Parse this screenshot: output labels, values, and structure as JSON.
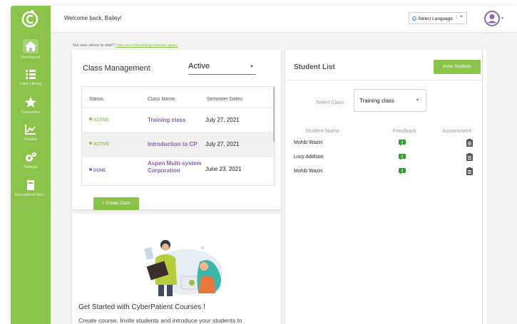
{
  "header": {
    "welcome": "Welcome back, Bailey!",
    "language_label": "Select Language",
    "language_arrow": "▼"
  },
  "sidebar": {
    "items": [
      {
        "label": "Dashboard",
        "icon": "home-icon",
        "active": true
      },
      {
        "label": "Case Library",
        "icon": "list-icon"
      },
      {
        "label": "Favourites",
        "icon": "star-icon"
      },
      {
        "label": "Grades",
        "icon": "chart-icon"
      },
      {
        "label": "Settings",
        "icon": "gears-icon"
      },
      {
        "label": "Educational Res...",
        "icon": "book-icon"
      }
    ]
  },
  "onboarding": {
    "text": "Not sure where to start?",
    "link": "View our onboarding tutorials again."
  },
  "class_management": {
    "title": "Class Management",
    "filter_value": "Active",
    "columns": [
      "Status.",
      "Class Name.",
      "Semester Dates"
    ],
    "rows": [
      {
        "status": "ACTIVE",
        "status_color": "#8bc34a",
        "name": "Training class",
        "date": "July 27, 2021"
      },
      {
        "status": "ACTIVE",
        "status_color": "#8bc34a",
        "name": "Introduction to CP",
        "date": "July 27, 2021"
      },
      {
        "status": "DONE",
        "status_color": "#7e6bc4",
        "name": "Aspen Multi-system Corporation",
        "date": "June 23, 2021"
      }
    ],
    "create_button": "+ Create Class"
  },
  "get_started": {
    "title": "Get Started with CyberPatient Courses !",
    "text": "Create course. Invite students and introduce your students to"
  },
  "student_list": {
    "title": "Student List",
    "invite_button": "Invite Students",
    "select_label": "Select Class:",
    "select_value": "Training class",
    "columns": [
      "Student Name",
      "Feedback",
      "Assessment"
    ],
    "students": [
      {
        "name": "Mohib Waziri"
      },
      {
        "name": "Lucy Addison"
      },
      {
        "name": "Mohib Waziri"
      }
    ]
  },
  "colors": {
    "brand_green": "#8bc34a",
    "class_name_purple": "#8c62a8",
    "done_purple": "#7e6bc4"
  }
}
